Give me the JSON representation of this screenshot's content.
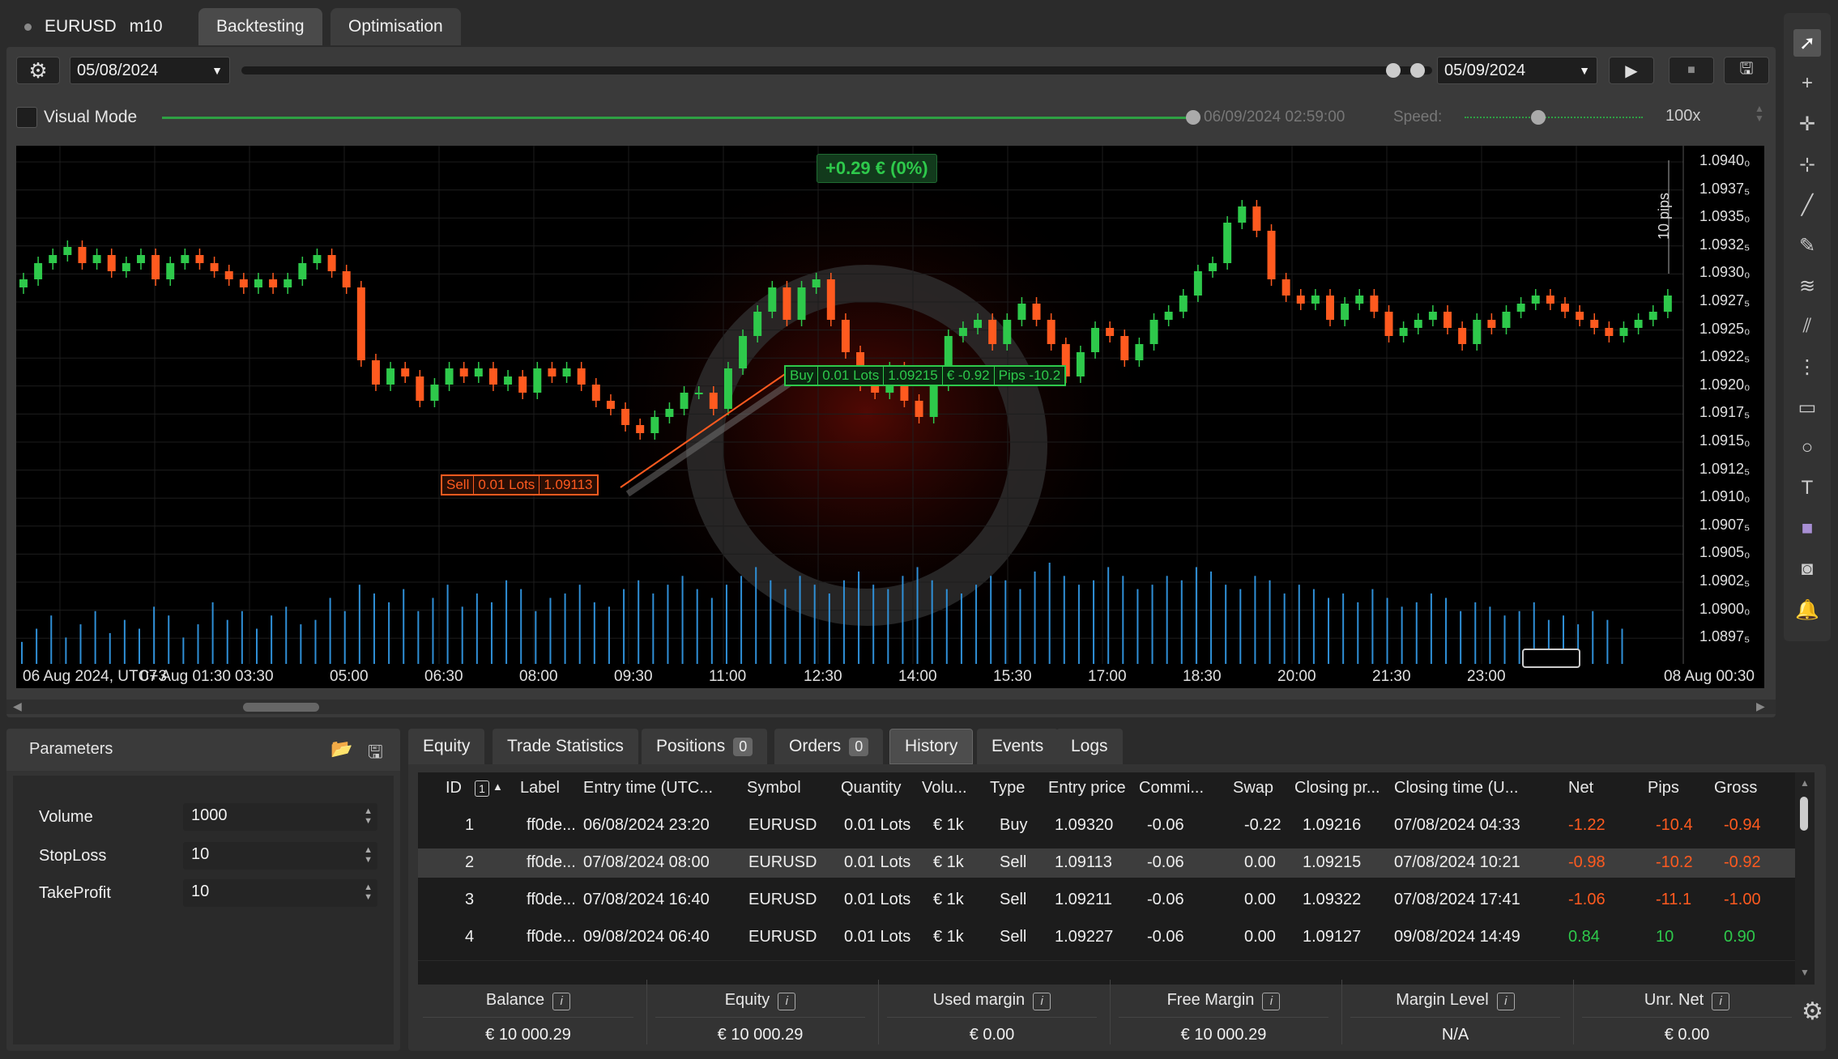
{
  "tabs": {
    "symbol": "EURUSD",
    "timeframe": "m10",
    "backtesting": "Backtesting",
    "optimisation": "Optimisation"
  },
  "controls": {
    "start_date": "05/08/2024",
    "end_date": "05/09/2024",
    "visual_mode": "Visual Mode",
    "current_time": "06/09/2024 02:59:00",
    "speed_label": "Speed:",
    "speed_value": "100x"
  },
  "chart_data": {
    "type": "candlestick",
    "title": "+0.29 € (0%)",
    "y_ticks": [
      "1.0940₀",
      "1.0937₅",
      "1.0935₀",
      "1.0932₅",
      "1.0930₀",
      "1.0927₅",
      "1.0925₀",
      "1.0922₅",
      "1.0920₀",
      "1.0917₅",
      "1.0915₀",
      "1.0912₅",
      "1.0910₀",
      "1.0907₅",
      "1.0905₀",
      "1.0902₅",
      "1.0900₀",
      "1.0897₅"
    ],
    "ylim": [
      1.08965,
      1.09415
    ],
    "x_ticks": [
      "06 Aug 2024, UTC+3",
      "07 Aug 01:30",
      "03:30",
      "05:00",
      "06:30",
      "08:00",
      "09:30",
      "11:00",
      "12:30",
      "14:00",
      "15:30",
      "17:00",
      "18:30",
      "20:00",
      "21:30",
      "23:00",
      "08 Aug 00:30"
    ],
    "pips_label": "10 pips",
    "trade_labels": {
      "sell": [
        "Sell",
        "0.01 Lots",
        "1.09113"
      ],
      "buy": [
        "Buy",
        "0.01 Lots",
        "1.09215",
        "€ -0.92",
        "Pips -10.2"
      ]
    },
    "close": [
      1.0927,
      1.0929,
      1.093,
      1.0931,
      1.0929,
      1.093,
      1.0928,
      1.0929,
      1.093,
      1.0927,
      1.0929,
      1.093,
      1.0929,
      1.0928,
      1.0927,
      1.0926,
      1.0927,
      1.0926,
      1.0927,
      1.0929,
      1.093,
      1.0928,
      1.0926,
      1.0917,
      1.0914,
      1.0916,
      1.0915,
      1.0912,
      1.0914,
      1.0916,
      1.0915,
      1.0916,
      1.0914,
      1.0915,
      1.0913,
      1.0916,
      1.0915,
      1.0916,
      1.0914,
      1.0912,
      1.0911,
      1.0909,
      1.0908,
      1.091,
      1.0911,
      1.0913,
      1.0913,
      1.0911,
      1.0916,
      1.092,
      1.0923,
      1.0926,
      1.0922,
      1.0926,
      1.0927,
      1.0922,
      1.0918,
      1.0914,
      1.0913,
      1.0916,
      1.0912,
      1.091,
      1.0914,
      1.092,
      1.0921,
      1.0922,
      1.0919,
      1.0922,
      1.0924,
      1.0922,
      1.0919,
      1.0915,
      1.0918,
      1.0921,
      1.092,
      1.0917,
      1.0919,
      1.0922,
      1.0923,
      1.0925,
      1.0928,
      1.0929,
      1.0934,
      1.0936,
      1.0933,
      1.0927,
      1.0925,
      1.0924,
      1.0925,
      1.0922,
      1.0924,
      1.0925,
      1.0923,
      1.092,
      1.0921,
      1.0922,
      1.0923,
      1.0921,
      1.0919,
      1.0922,
      1.0921,
      1.0923,
      1.0924,
      1.0925,
      1.0924,
      1.0923,
      1.0922,
      1.0921,
      1.092,
      1.0921,
      1.0922,
      1.0923,
      1.0925
    ],
    "volumes": [
      25,
      40,
      55,
      30,
      45,
      60,
      35,
      50,
      40,
      65,
      55,
      30,
      45,
      70,
      50,
      60,
      40,
      55,
      65,
      45,
      50,
      75,
      60,
      90,
      80,
      70,
      85,
      60,
      75,
      90,
      65,
      80,
      70,
      95,
      85,
      60,
      75,
      80,
      90,
      70,
      65,
      85,
      95,
      80,
      90,
      100,
      85,
      75,
      90,
      100,
      110,
      95,
      85,
      100,
      90,
      80,
      95,
      105,
      90,
      85,
      100,
      110,
      95,
      85,
      80,
      90,
      100,
      95,
      85,
      105,
      115,
      100,
      90,
      95,
      110,
      100,
      85,
      90,
      100,
      95,
      110,
      105,
      90,
      85,
      100,
      95,
      80,
      90,
      85,
      75,
      80,
      70,
      85,
      75,
      65,
      70,
      80,
      75,
      60,
      70,
      65,
      55,
      60,
      70,
      50,
      55,
      45,
      60,
      50,
      40
    ]
  },
  "positions_count": "0",
  "orders_count": "0",
  "bottom_tabs": [
    "Equity",
    "Trade Statistics",
    "Positions",
    "Orders",
    "History",
    "Events",
    "Logs"
  ],
  "history": {
    "columns": [
      "ID",
      "Label",
      "Entry time (UTC...",
      "Symbol",
      "Quantity",
      "Volu...",
      "Type",
      "Entry price",
      "Commi...",
      "Swap",
      "Closing pr...",
      "Closing time (U...",
      "Net",
      "Pips",
      "Gross"
    ],
    "sort_index": "1",
    "rows": [
      [
        "1",
        "ff0de...",
        "06/08/2024 23:20",
        "EURUSD",
        "0.01 Lots",
        "€ 1k",
        "Buy",
        "1.09320",
        "-0.06",
        "-0.22",
        "1.09216",
        "07/08/2024 04:33",
        "-1.22",
        "-10.4",
        "-0.94"
      ],
      [
        "2",
        "ff0de...",
        "07/08/2024 08:00",
        "EURUSD",
        "0.01 Lots",
        "€ 1k",
        "Sell",
        "1.09113",
        "-0.06",
        "0.00",
        "1.09215",
        "07/08/2024 10:21",
        "-0.98",
        "-10.2",
        "-0.92"
      ],
      [
        "3",
        "ff0de...",
        "07/08/2024 16:40",
        "EURUSD",
        "0.01 Lots",
        "€ 1k",
        "Sell",
        "1.09211",
        "-0.06",
        "0.00",
        "1.09322",
        "07/08/2024 17:41",
        "-1.06",
        "-11.1",
        "-1.00"
      ],
      [
        "4",
        "ff0de...",
        "09/08/2024 06:40",
        "EURUSD",
        "0.01 Lots",
        "€ 1k",
        "Sell",
        "1.09227",
        "-0.06",
        "0.00",
        "1.09127",
        "09/08/2024 14:49",
        "0.84",
        "10",
        "0.90"
      ]
    ]
  },
  "summary": [
    {
      "label": "Balance",
      "value": "€ 10 000.29"
    },
    {
      "label": "Equity",
      "value": "€ 10 000.29"
    },
    {
      "label": "Used margin",
      "value": "€ 0.00"
    },
    {
      "label": "Free Margin",
      "value": "€ 10 000.29"
    },
    {
      "label": "Margin Level",
      "value": "N/A"
    },
    {
      "label": "Unr. Net",
      "value": "€ 0.00"
    }
  ],
  "parameters": {
    "title": "Parameters",
    "items": [
      {
        "label": "Volume",
        "value": "1000"
      },
      {
        "label": "StopLoss",
        "value": "10"
      },
      {
        "label": "TakeProfit",
        "value": "10"
      }
    ]
  },
  "colors": {
    "up": "#2ec94b",
    "down": "#ff5a1f",
    "volume": "#2f8fd6",
    "background": "#000000"
  }
}
